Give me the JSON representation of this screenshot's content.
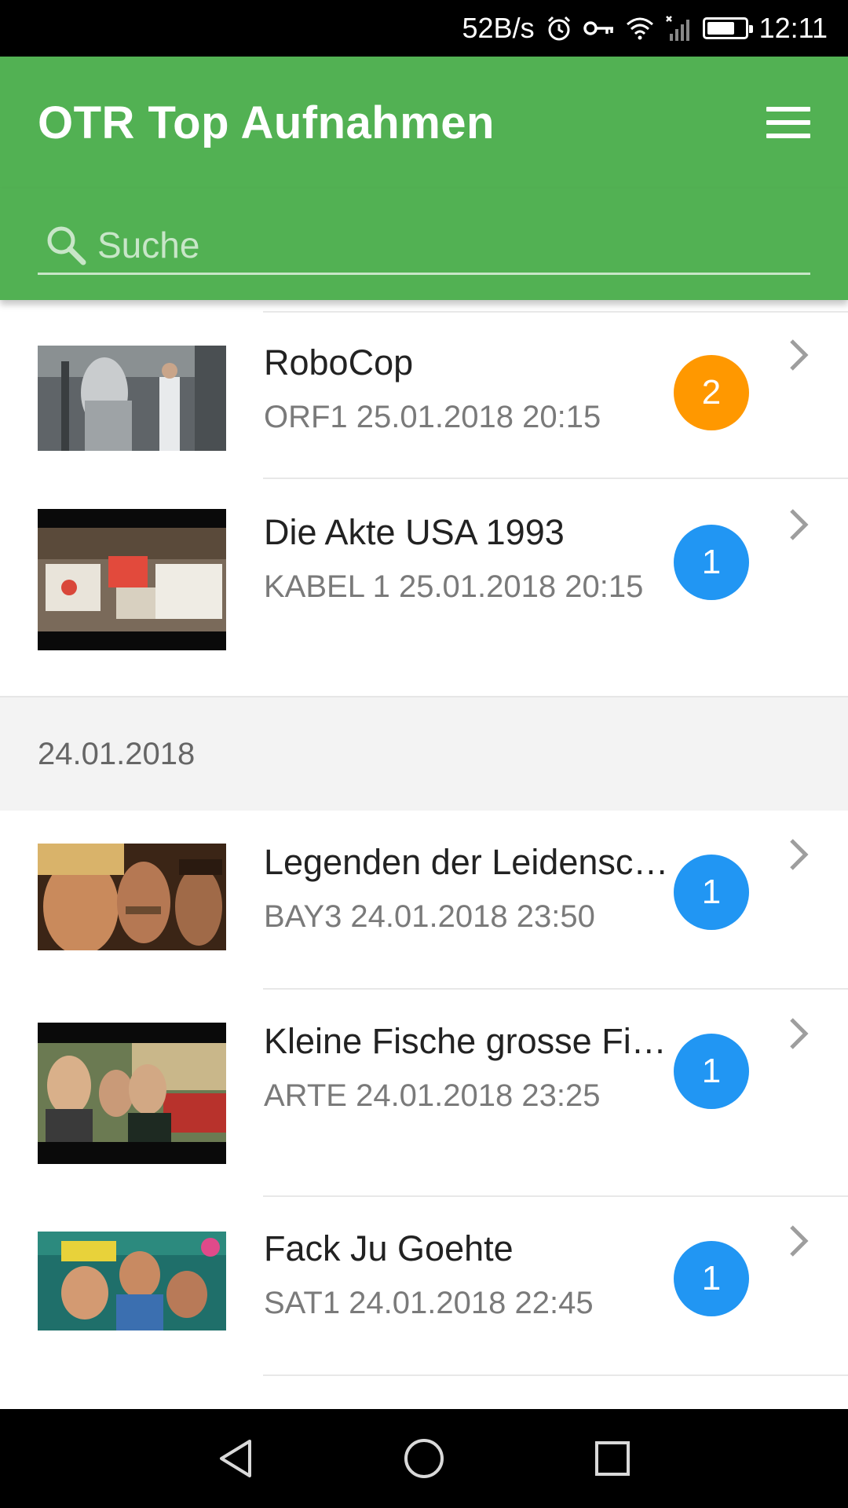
{
  "status_bar": {
    "speed": "52B/s",
    "time": "12:11",
    "battery_level": 0.75,
    "icons": [
      "alarm-icon",
      "vpn-key-icon",
      "wifi-icon",
      "signal-icon",
      "battery-icon"
    ]
  },
  "app_bar": {
    "title": "OTR Top Aufnahmen",
    "menu_icon": "hamburger-menu-icon"
  },
  "search": {
    "placeholder": "Suche",
    "value": "",
    "icon": "search-icon"
  },
  "colors": {
    "primary": "#52b153",
    "badge_orange": "#ff9800",
    "badge_blue": "#2196f3"
  },
  "sections": [
    {
      "date": "",
      "items": [
        {
          "title": "RoboCop",
          "subtitle": "ORF1 25.01.2018 20:15",
          "count": "2",
          "badge_color": "#ff9800"
        },
        {
          "title": "Die Akte USA 1993",
          "subtitle": "KABEL 1 25.01.2018 20:15",
          "count": "1",
          "badge_color": "#2196f3"
        }
      ]
    },
    {
      "date": "24.01.2018",
      "items": [
        {
          "title": "Legenden der Leidenschaft",
          "subtitle": "BAY3 24.01.2018 23:50",
          "count": "1",
          "badge_color": "#2196f3"
        },
        {
          "title": "Kleine Fische grosse Fische",
          "subtitle": "ARTE 24.01.2018 23:25",
          "count": "1",
          "badge_color": "#2196f3"
        },
        {
          "title": "Fack Ju Goehte",
          "subtitle": "SAT1 24.01.2018 22:45",
          "count": "1",
          "badge_color": "#2196f3"
        }
      ]
    }
  ],
  "nav_bar": {
    "icons": [
      "back-icon",
      "home-icon",
      "recents-icon"
    ]
  }
}
